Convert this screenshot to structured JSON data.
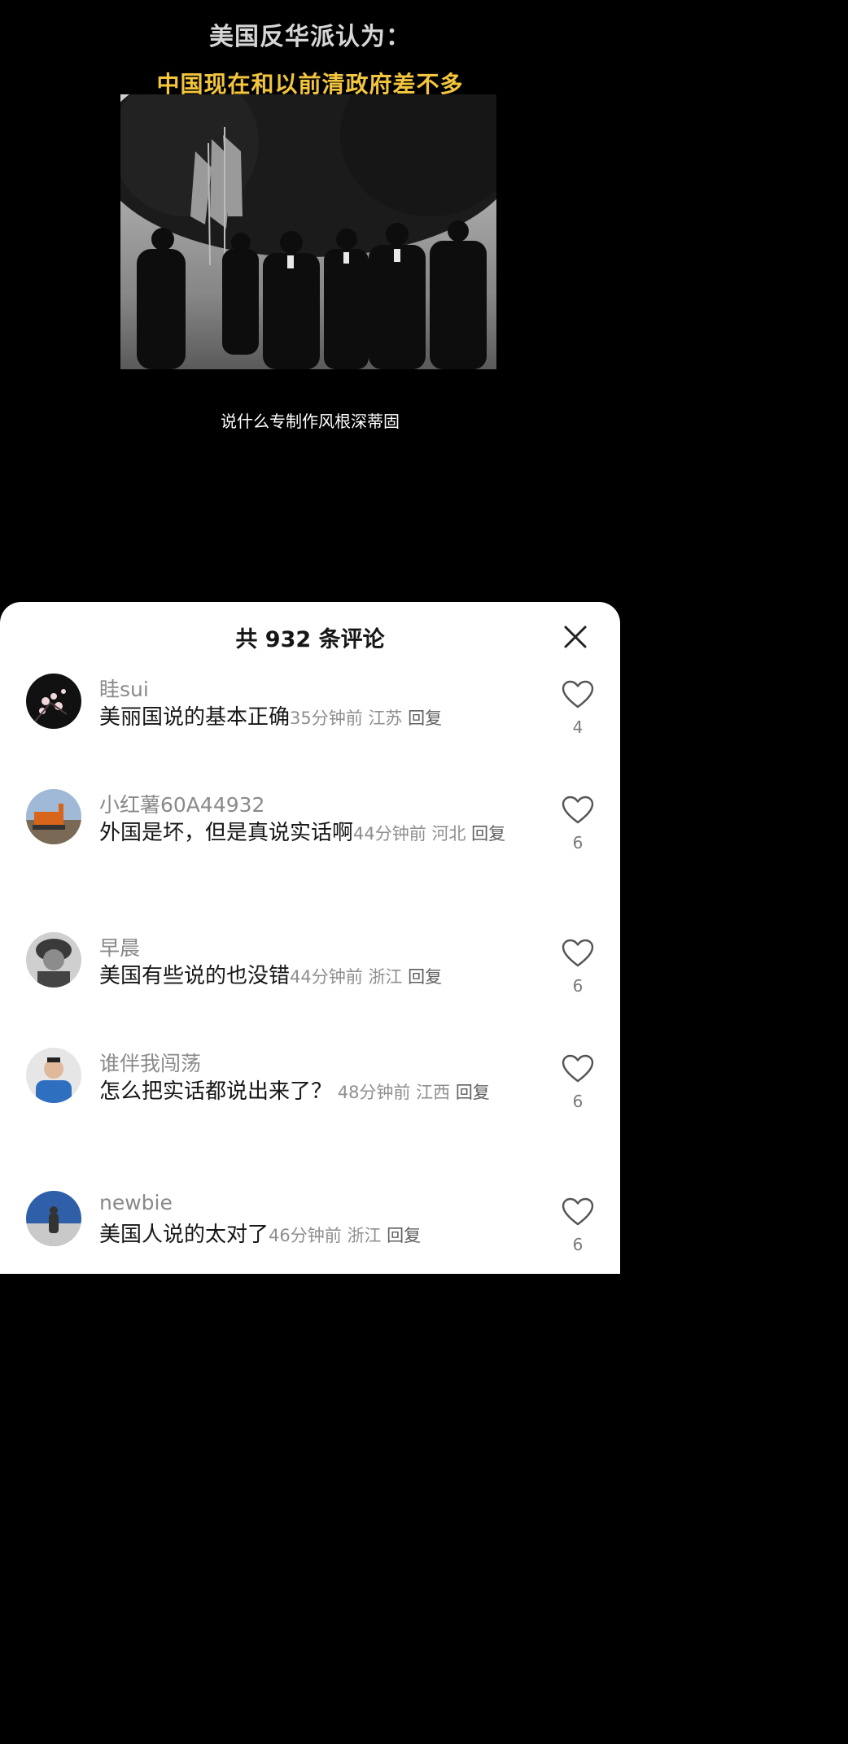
{
  "video": {
    "headline_line1": "美国反华派认为：",
    "headline_line2": "中国现在和以前清政府差不多",
    "subtitle": "说什么专制作风根深蒂固",
    "accent_yellow": "#f2c53d"
  },
  "comments_panel": {
    "title": "共 932 条评论",
    "close_icon": "close-icon",
    "comments": [
      {
        "username": "眭sui",
        "text": "美丽国说的基本正确",
        "time": "35分钟前",
        "location": "江苏",
        "reply": "回复",
        "likes": "4"
      },
      {
        "username": "小红薯60A44932",
        "text": "外国是坏，但是真说实话啊",
        "time": "44分钟前",
        "location": "河北",
        "reply": "回复",
        "likes": "6"
      },
      {
        "username": "早晨",
        "text": "美国有些说的也没错",
        "time": "44分钟前",
        "location": "浙江",
        "reply": "回复",
        "likes": "6"
      },
      {
        "username": "谁伴我闯荡",
        "text": "怎么把实话都说出来了？",
        "time": "48分钟前",
        "location": "江西",
        "reply": "回复",
        "likes": "6"
      },
      {
        "username": "newbie",
        "text": "美国人说的太对了",
        "time": "46分钟前",
        "location": "浙江",
        "reply": "回复",
        "likes": "6"
      }
    ]
  }
}
